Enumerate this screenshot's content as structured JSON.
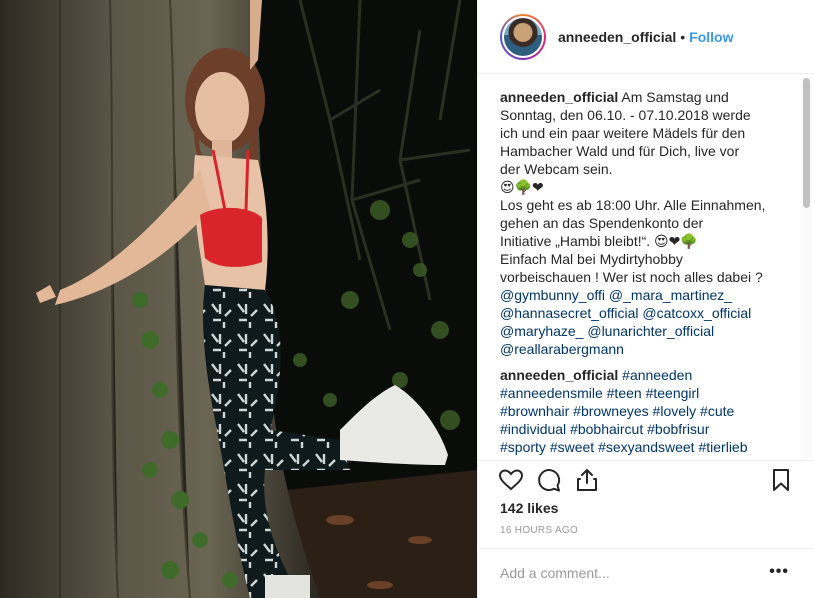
{
  "header": {
    "username": "anneeden_official",
    "separator": "•",
    "follow_label": "Follow"
  },
  "caption": {
    "author": "anneeden_official",
    "lines": [
      "Am Samstag und",
      "Sonntag, den 06.10. - 07.10.2018 werde",
      "ich und ein paar weitere Mädels für den",
      "Hambacher Wald und für Dich, live vor",
      "der Webcam sein.",
      "😍🌳❤",
      "Los geht es ab 18:00 Uhr. Alle Einnahmen,",
      "gehen an das Spendenkonto der",
      "Initiative „Hambi bleibt!“. 😍❤🌳",
      "Einfach Mal bei Mydirtyhobby",
      "vorbeischauen ! Wer ist noch alles dabei ?"
    ],
    "mentions": [
      [
        "@gymbunny_offi",
        "@_mara_martinez_"
      ],
      [
        "@hannasecret_official",
        "@catcoxx_official"
      ],
      [
        "@maryhaze_",
        "@lunarichter_official"
      ],
      [
        "@reallarabergmann"
      ]
    ]
  },
  "comment2": {
    "author": "anneeden_official",
    "hashtag_lines": [
      [
        "#anneeden"
      ],
      [
        "#anneedensmile",
        "#teen",
        "#teengirl"
      ],
      [
        "#brownhair",
        "#browneyes",
        "#lovely",
        "#cute"
      ],
      [
        "#individual",
        "#bobhaircut",
        "#bobfrisur"
      ],
      [
        "#sporty",
        "#sweet",
        "#sexyandsweet",
        "#tierlieb"
      ]
    ]
  },
  "actions": {
    "icons": [
      "heart-icon",
      "comment-icon",
      "share-icon",
      "bookmark-icon"
    ],
    "likes": "142 likes",
    "timestamp": "16 HOURS AGO"
  },
  "add_comment": {
    "placeholder": "Add a comment...",
    "more": "•••"
  },
  "colors": {
    "link": "#003569",
    "follow": "#3897f0",
    "muted": "#999999"
  }
}
